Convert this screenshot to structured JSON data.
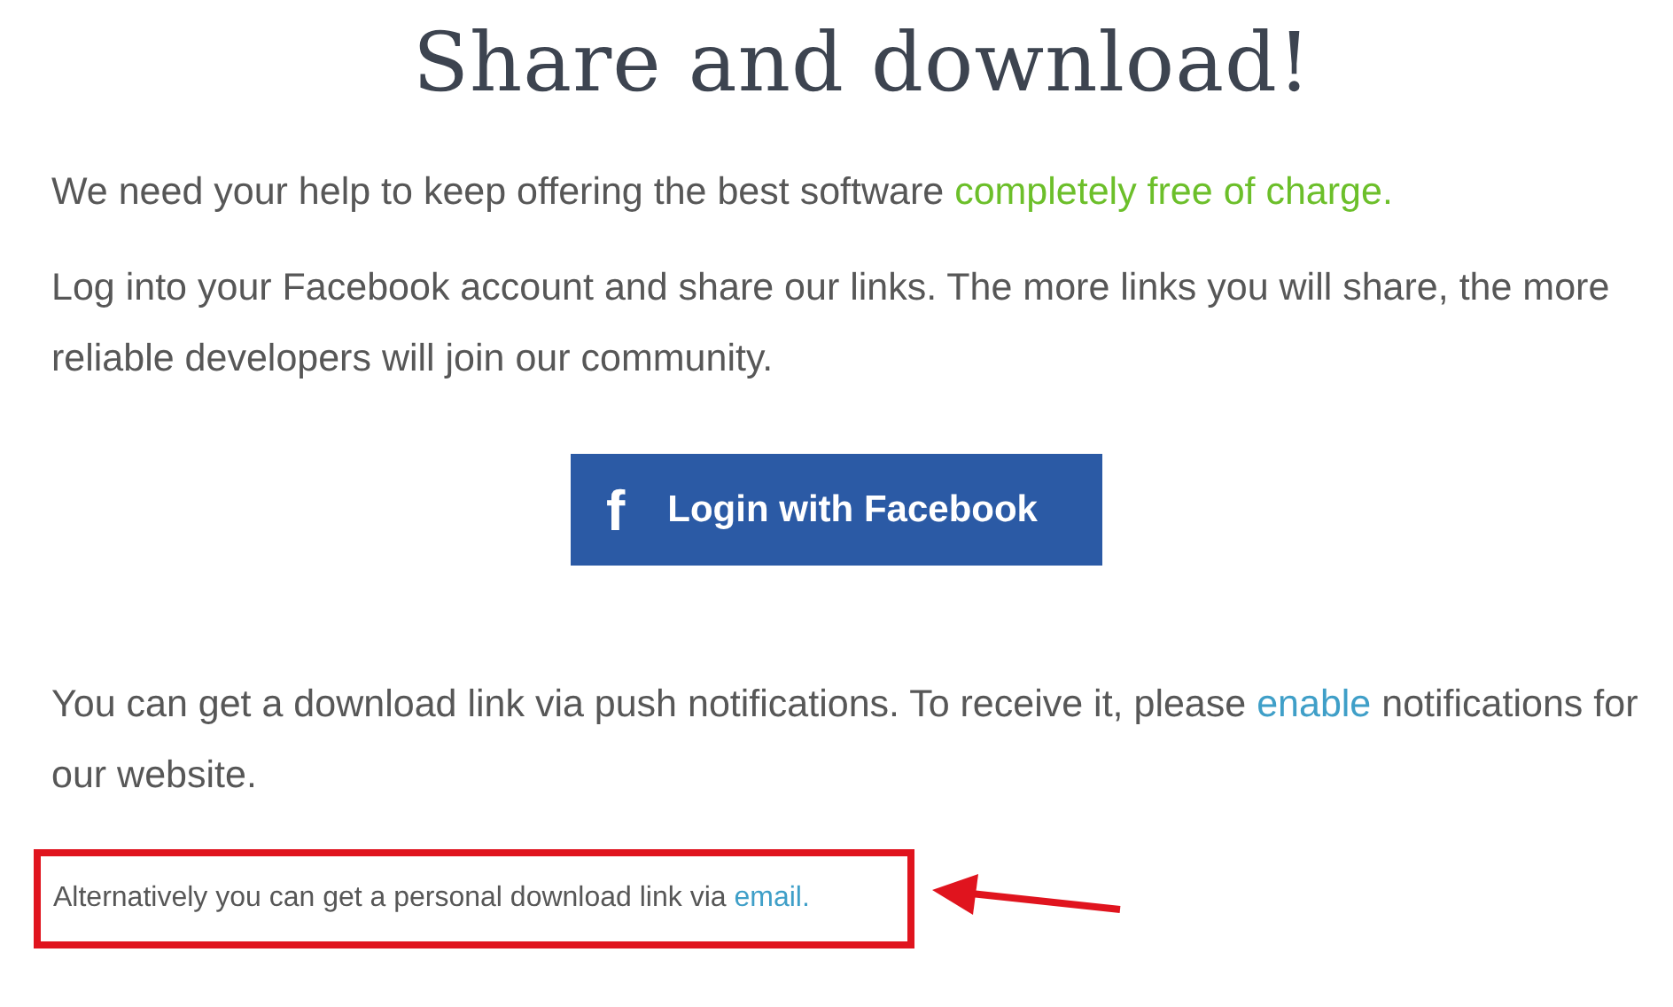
{
  "title": "Share and download!",
  "paragraphs": [
    {
      "segments": [
        {
          "kind": "plain",
          "text": "We need your help to keep offering the best software "
        },
        {
          "kind": "accent",
          "text": "completely free of charge."
        }
      ]
    },
    {
      "segments": [
        {
          "kind": "plain",
          "text": "Log into your Facebook account and share our links. The more links you will share, the more reliable developers will join our community."
        }
      ]
    }
  ],
  "login_button": {
    "icon": "f",
    "label": "Login with Facebook"
  },
  "push_note": {
    "segments": [
      {
        "kind": "plain",
        "text": "You can get a download link via push notifications. To receive it, please "
      },
      {
        "kind": "link",
        "text": "enable"
      },
      {
        "kind": "plain",
        "text": " notifications for our website."
      }
    ]
  },
  "email_note": {
    "kind": "boxed-with-arrow",
    "segments": [
      {
        "kind": "plain",
        "text": "Alternatively you can get a personal download link via "
      },
      {
        "kind": "link",
        "text": "email."
      }
    ]
  }
}
